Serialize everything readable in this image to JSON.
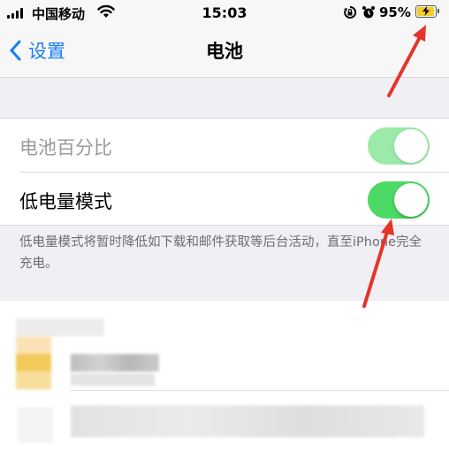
{
  "status_bar": {
    "carrier": "中国移动",
    "time": "15:03",
    "battery_percent": "95%",
    "battery_level": 0.95,
    "signal_icon": "signal-bars-icon",
    "wifi_icon": "wifi-icon",
    "rotation_lock_icon": "rotation-lock-icon",
    "alarm_icon": "alarm-icon",
    "battery_icon": "battery-charging-icon"
  },
  "nav": {
    "back_label": "设置",
    "title": "电池"
  },
  "settings": {
    "battery_percentage": {
      "label": "电池百分比",
      "on": true,
      "enabled": false
    },
    "low_power_mode": {
      "label": "低电量模式",
      "on": true,
      "enabled": true
    }
  },
  "footnote": "低电量模式将暂时降低如下载和邮件获取等后台活动，直至iPhone完全充电。",
  "colors": {
    "accent": "#1a7df3",
    "toggle_on": "#4cd964",
    "annotation_arrow": "#e5342a",
    "background": "#efeff4"
  }
}
